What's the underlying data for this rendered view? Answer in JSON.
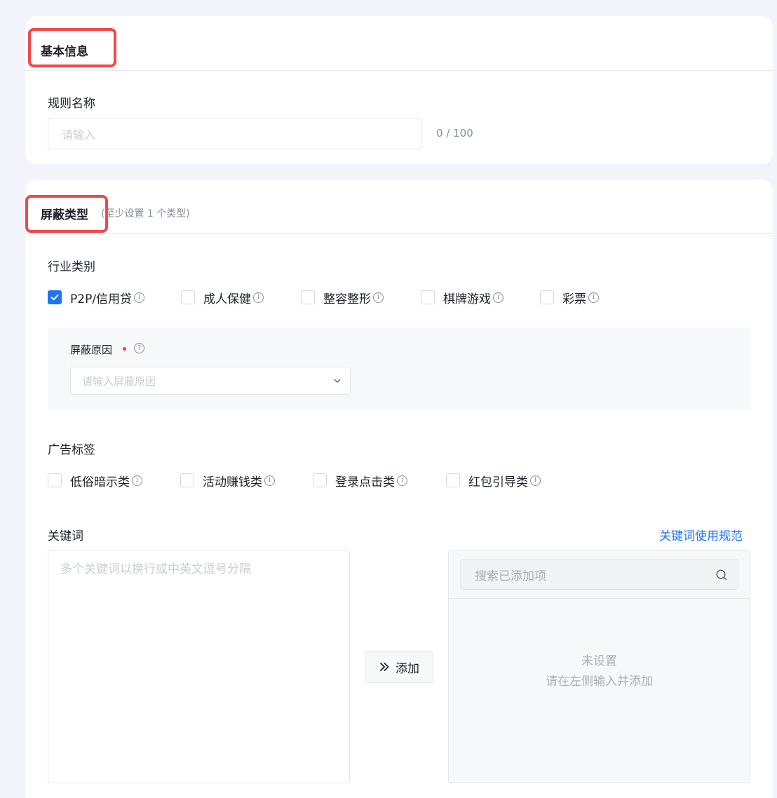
{
  "basic": {
    "title": "基本信息",
    "rule_name_label": "规则名称",
    "rule_name_placeholder": "请输入",
    "rule_name_counter": "0 / 100"
  },
  "block": {
    "title": "屏蔽类型",
    "subtitle": "(至少设置 1 个类型)",
    "industry_label": "行业类别",
    "industry_options": [
      {
        "label": "P2P/信用贷",
        "checked": true
      },
      {
        "label": "成人保健",
        "checked": false
      },
      {
        "label": "整容整形",
        "checked": false
      },
      {
        "label": "棋牌游戏",
        "checked": false
      },
      {
        "label": "彩票",
        "checked": false
      }
    ],
    "reason_label": "屏蔽原因",
    "reason_placeholder": "请输入屏蔽原因",
    "ad_tags_label": "广告标签",
    "ad_tag_options": [
      {
        "label": "低俗暗示类",
        "checked": false
      },
      {
        "label": "活动赚钱类",
        "checked": false
      },
      {
        "label": "登录点击类",
        "checked": false
      },
      {
        "label": "红包引导类",
        "checked": false
      }
    ],
    "keywords_label": "关键词",
    "keywords_rule_link": "关键词使用规范",
    "keywords_placeholder": "多个关键词以换行或中英文逗号分隔",
    "add_button": "添加",
    "search_placeholder": "搜索已添加项",
    "empty_title": "未设置",
    "empty_hint": "请在左侧输入并添加"
  },
  "colors": {
    "accent": "#1d74f5",
    "highlight_box": "#ef4a4a",
    "required": "#f53f3f"
  }
}
